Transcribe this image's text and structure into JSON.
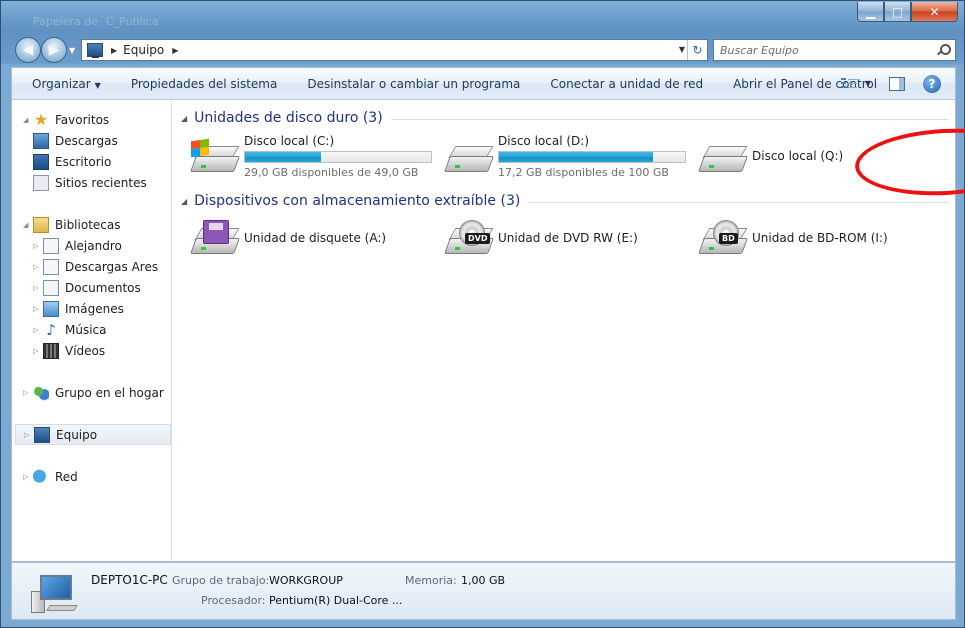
{
  "window": {
    "ghost_title_left": "Papelera de",
    "ghost_title_right": "C_Publica",
    "minimize": "▁",
    "maximize": "□",
    "close": "✕"
  },
  "address": {
    "location": "Equipo",
    "refresh": "↻"
  },
  "search": {
    "placeholder": "Buscar Equipo"
  },
  "toolbar": {
    "organize": "Organizar",
    "items": [
      "Propiedades del sistema",
      "Desinstalar o cambiar un programa",
      "Conectar a unidad de red",
      "Abrir el Panel de control"
    ],
    "help": "?"
  },
  "sidebar": {
    "favorites": {
      "label": "Favoritos",
      "items": [
        "Descargas",
        "Escritorio",
        "Sitios recientes"
      ]
    },
    "libraries": {
      "label": "Bibliotecas",
      "items": [
        "Alejandro",
        "Descargas Ares",
        "Documentos",
        "Imágenes",
        "Música",
        "Vídeos"
      ]
    },
    "homegroup": "Grupo en el hogar",
    "computer": "Equipo",
    "network": "Red"
  },
  "hard_drives": {
    "header": "Unidades de disco duro (3)",
    "drives": [
      {
        "name": "Disco local (C:)",
        "free_text": "29,0 GB disponibles de 49,0 GB",
        "used_fraction": 0.41
      },
      {
        "name": "Disco local (D:)",
        "free_text": "17,2 GB disponibles de 100 GB",
        "used_fraction": 0.83
      },
      {
        "name": "Disco local (Q:)"
      }
    ]
  },
  "removable": {
    "header": "Dispositivos con almacenamiento extraíble (3)",
    "devices": [
      {
        "name": "Unidad de disquete (A:)"
      },
      {
        "name": "Unidad de DVD RW (E:)",
        "badge": "DVD"
      },
      {
        "name": "Unidad de BD-ROM (I:)",
        "badge": "BD"
      }
    ]
  },
  "details": {
    "computer_name": "DEPTO1C-PC",
    "workgroup_label": "Grupo de trabajo:",
    "workgroup_value": "WORKGROUP",
    "memory_label": "Memoria:",
    "memory_value": "1,00 GB",
    "processor_label": "Procesador:",
    "processor_value": "Pentium(R) Dual-Core  ..."
  },
  "colors": {
    "annotation": "#ee1111",
    "group_header": "#1e3287",
    "bar_fill": "#22a3d6"
  }
}
